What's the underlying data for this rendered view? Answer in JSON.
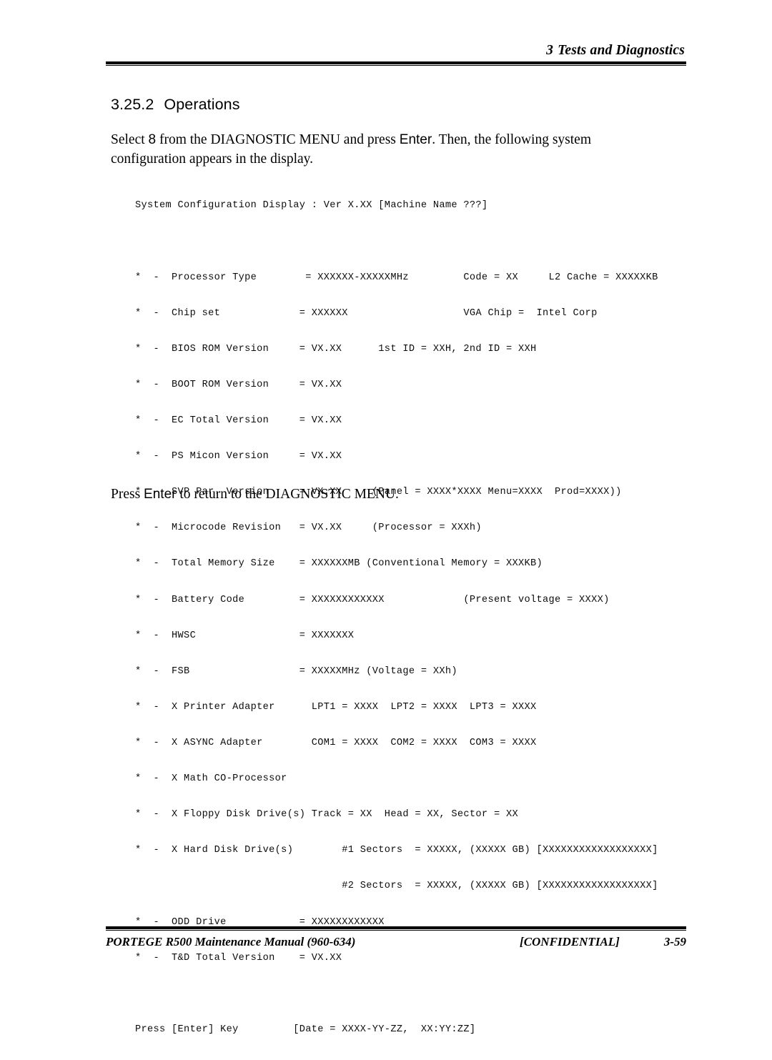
{
  "header": {
    "chapter_number": "3",
    "chapter_title": "Tests and Diagnostics"
  },
  "section": {
    "number": "3.25.2",
    "title": "Operations"
  },
  "intro_paragraph": {
    "before_key": "Select ",
    "menu_key": "8",
    "middle": " from the DIAGNOSTIC MENU and press ",
    "enter_key": "Enter",
    "after_key": ". Then, the following system configuration appears in the display."
  },
  "outro_paragraph": {
    "before_key": "Press ",
    "enter_key": "Enter",
    "after_key": " to return to the DIAGNOSTIC MENU."
  },
  "console": {
    "title_line": "System Configuration Display : Ver X.XX [Machine Name ???]",
    "lines": [
      "*  -  Processor Type        = XXXXXX-XXXXXMHz         Code = XX     L2 Cache = XXXXXKB",
      "*  -  Chip set             = XXXXXX                   VGA Chip =  Intel Corp",
      "*  -  BIOS ROM Version     = VX.XX      1st ID = XXH, 2nd ID = XXH",
      "*  -  BOOT ROM Version     = VX.XX",
      "*  -  EC Total Version     = VX.XX",
      "*  -  PS Micon Version     = VX.XX",
      "*  -  SVP Par. Version     = VX.XX     (Panel = XXXX*XXXX Menu=XXXX  Prod=XXXX))",
      "*  -  Microcode Revision   = VX.XX     (Processor = XXXh)",
      "*  -  Total Memory Size    = XXXXXXMB (Conventional Memory = XXXKB)",
      "*  -  Battery Code         = XXXXXXXXXXXX             (Present voltage = XXXX)",
      "*  -  HWSC                 = XXXXXXX",
      "*  -  FSB                  = XXXXXMHz (Voltage = XXh)",
      "*  -  X Printer Adapter      LPT1 = XXXX  LPT2 = XXXX  LPT3 = XXXX",
      "*  -  X ASYNC Adapter        COM1 = XXXX  COM2 = XXXX  COM3 = XXXX",
      "*  -  X Math CO-Processor",
      "*  -  X Floppy Disk Drive(s) Track = XX  Head = XX, Sector = XX",
      "*  -  X Hard Disk Drive(s)        #1 Sectors  = XXXXX, (XXXXX GB) [XXXXXXXXXXXXXXXXXX]",
      "                                  #2 Sectors  = XXXXX, (XXXXX GB) [XXXXXXXXXXXXXXXXXX]",
      "*  -  ODD Drive            = XXXXXXXXXXXX",
      "*  -  T&D Total Version    = VX.XX"
    ],
    "prompt_line": "Press [Enter] Key         [Date = XXXX-YY-ZZ,  XX:YY:ZZ]"
  },
  "footer": {
    "left": "PORTEGE R500 Maintenance Manual (960-634)",
    "center": "[CONFIDENTIAL]",
    "page_number": "3-59"
  }
}
